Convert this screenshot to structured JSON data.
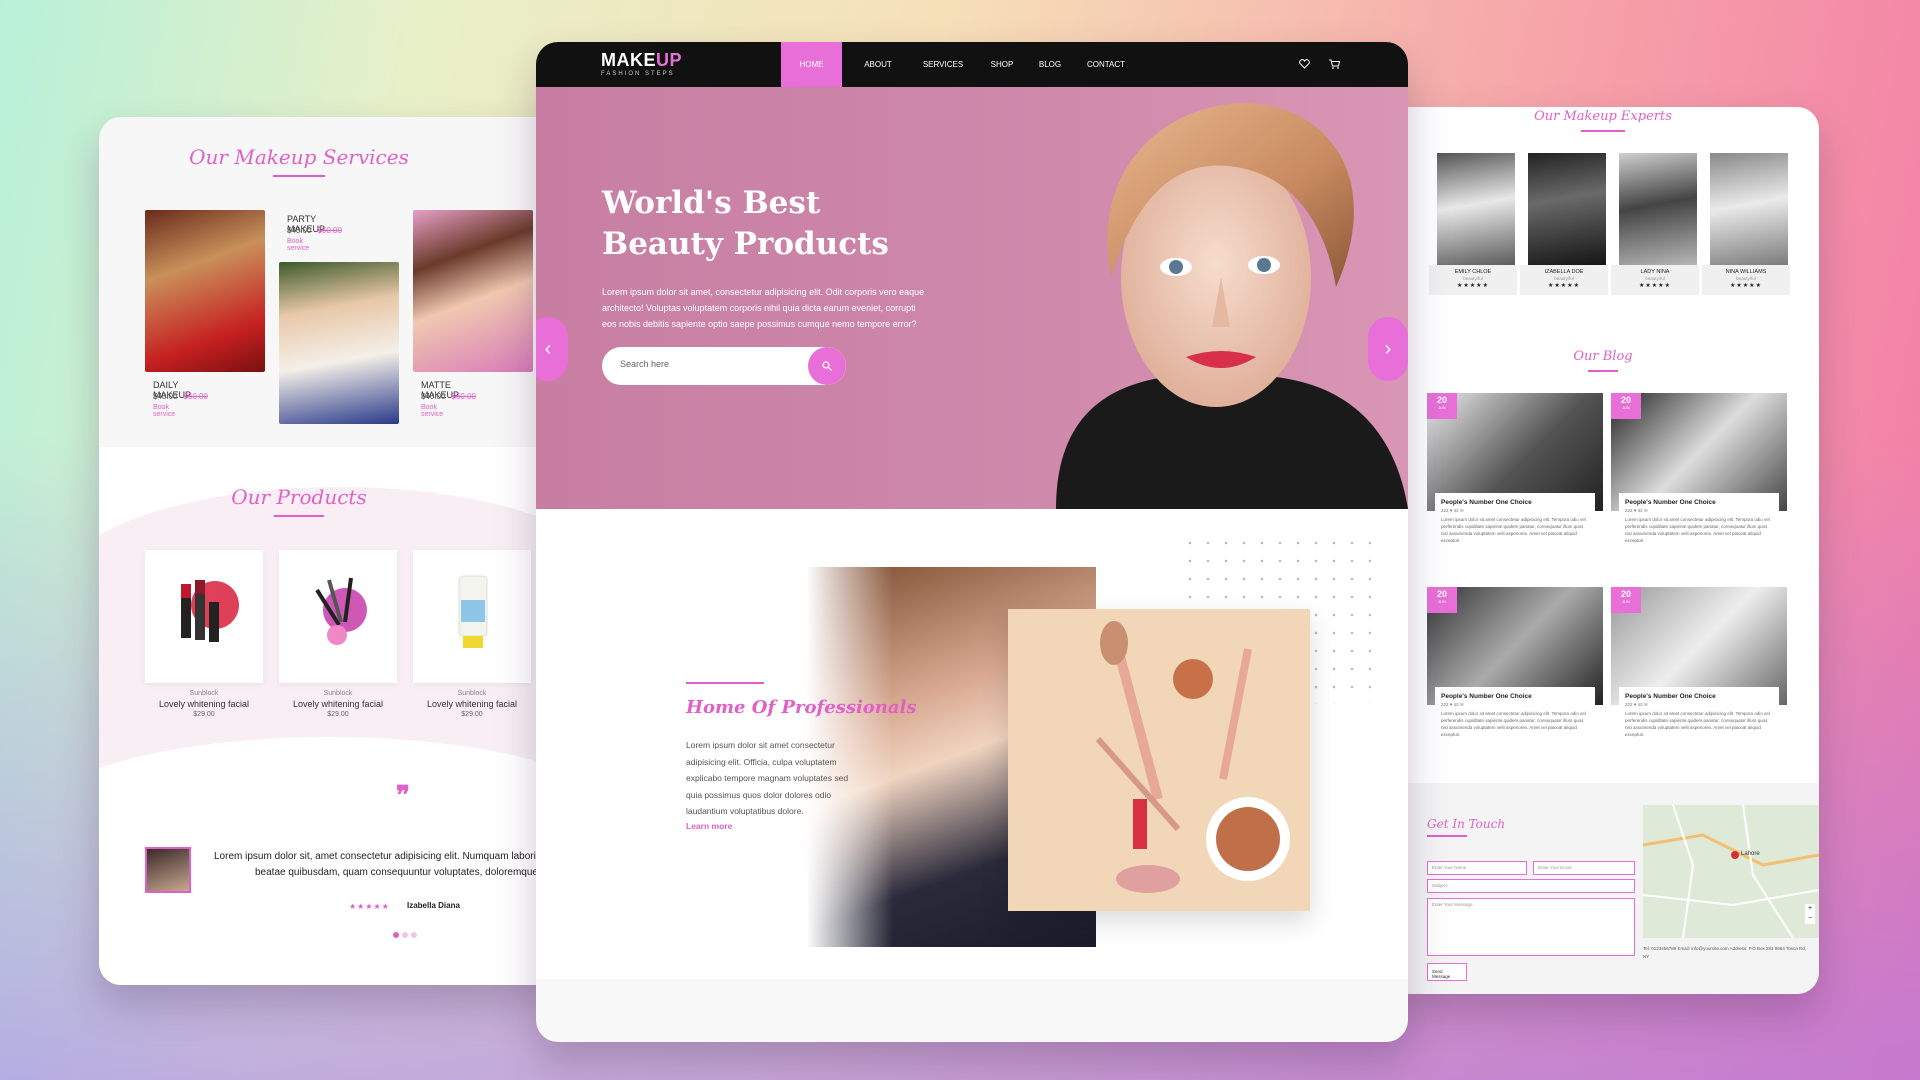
{
  "colors": {
    "accent": "#e86fd8",
    "hero_bg": "#cd87aa",
    "nav_bg": "#111111"
  },
  "left": {
    "services_title": "Our Makeup Services",
    "services": [
      {
        "name": "DAILY MAKEUP",
        "price": "$40.00",
        "old_price": "$60.00",
        "cta": "Book service"
      },
      {
        "name": "PARTY MAKEUP",
        "price": "$40.00",
        "old_price": "$60.00",
        "cta": "Book service"
      },
      {
        "name": "MATTE MAKEUP",
        "price": "$40.00",
        "old_price": "$60.00",
        "cta": "Book service"
      }
    ],
    "products_title": "Our Products",
    "products": [
      {
        "category": "Sunblock",
        "title": "Lovely whitening facial",
        "price": "$29.00"
      },
      {
        "category": "Sunblock",
        "title": "Lovely whitening facial",
        "price": "$29.00"
      },
      {
        "category": "Sunblock",
        "title": "Lovely whitening facial",
        "price": "$29.00"
      }
    ],
    "testimonial": {
      "quote_icon": "quote-icon",
      "line1": "Lorem ipsum dolor sit, amet consectetur adipisicing elit. Numquam laborios",
      "line2": "beatae quibusdam, quam consequuntur voluptates, doloremque do",
      "stars": "★★★★★",
      "author": "Izabella Diana"
    }
  },
  "center": {
    "logo_main": "MAKE",
    "logo_accent": "UP",
    "logo_sub": "FASHION STEPS",
    "nav": [
      "HOME",
      "ABOUT",
      "SERVICES",
      "SHOP",
      "BLOG",
      "CONTACT"
    ],
    "heart_icon": "heart-icon",
    "cart_icon": "cart-icon",
    "hero": {
      "title": "World's Best Beauty Products",
      "text": "Lorem ipsum dolor sit amet, consectetur adipisicing elit. Odit corporis vero eaque architecto! Voluptas voluptatem corporis nihil quia dicta earum eveniet, corrupti eos nobis debitis sapiente optio saepe possimus cumque nemo tempore error?",
      "search_placeholder": "Search here",
      "prev": "‹",
      "next": "›"
    },
    "about": {
      "title": "Home Of Professionals",
      "text": "Lorem ipsum dolor sit amet consectetur adipisicing elit. Officia, culpa voluptatem explicabo tempore magnam voluptates sed quia possimus quos dolor dolores odio laudantium voluptatibus dolore.",
      "link": "Learn more"
    }
  },
  "right": {
    "experts_title": "Our Makeup Experts",
    "experts": [
      {
        "name": "EMILY CHLOE",
        "role": "beauty/ful",
        "stars": "★★★★★"
      },
      {
        "name": "IZABELLA DOE",
        "role": "beauty/ful",
        "stars": "★★★★★"
      },
      {
        "name": "LADY NINA",
        "role": "beauty/ful",
        "stars": "★★★★★"
      },
      {
        "name": "NINA WILLIAMS",
        "role": "beauty/ful",
        "stars": "★★★★★"
      }
    ],
    "blog_title": "Our Blog",
    "blogs": [
      {
        "day": "20",
        "month": "JUN",
        "title": "People's Number One Choice",
        "meta": "222 ♥  42 ✉",
        "text": "Lorem ipsum dolor sit amet consectetur adipisicing elit. Tempora odio vel perferendis cupiditate sapiente quidem pariatur, consequatur illum quos nisi assumenda voluptatem velit asperiores. Amet vel placeat aliquid excepturi."
      },
      {
        "day": "20",
        "month": "JUN",
        "title": "People's Number One Choice",
        "meta": "222 ♥  42 ✉",
        "text": "Lorem ipsum dolor sit amet consectetur adipisicing elit. Tempora odio vel perferendis cupiditate sapiente quidem pariatur, consequatur illum quos nisi assumenda voluptatem velit asperiores. Amet vel placeat aliquid excepturi."
      },
      {
        "day": "20",
        "month": "JUN",
        "title": "People's Number One Choice",
        "meta": "222 ♥  42 ✉",
        "text": "Lorem ipsum dolor sit amet consectetur adipisicing elit. Tempora odio vel perferendis cupiditate sapiente quidem pariatur, consequatur illum quos nisi assumenda voluptatem velit asperiores. Amet vel placeat aliquid excepturi."
      },
      {
        "day": "20",
        "month": "JUN",
        "title": "People's Number One Choice",
        "meta": "222 ♥  42 ✉",
        "text": "Lorem ipsum dolor sit amet consectetur adipisicing elit. Tempora odio vel perferendis cupiditate sapiente quidem pariatur, consequatur illum quos nisi assumenda voluptatem velit asperiores. Amet vel placeat aliquid excepturi."
      }
    ],
    "contact": {
      "title": "Get In Touch",
      "name_placeholder": "Enter Your Name",
      "email_placeholder": "Enter Your Email",
      "subject_placeholder": "Subject",
      "message_placeholder": "Enter Your Message",
      "send": "Send Message",
      "map_label": "Lahore",
      "address": "Tel: 0123456789 Email: info@yoursite.com Address: P.O Box 283 8964 Tosca Rd, NY"
    }
  }
}
